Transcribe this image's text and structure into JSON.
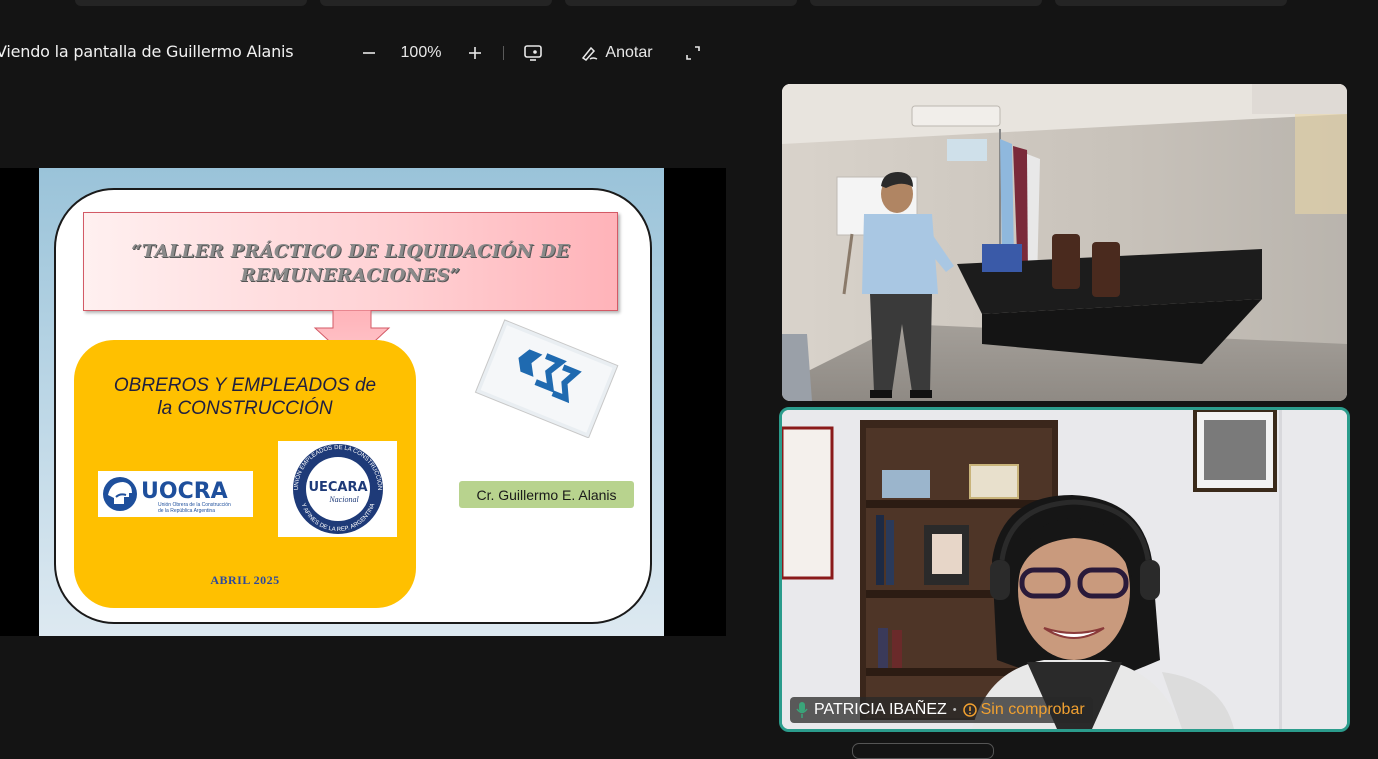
{
  "toolbar": {
    "share_title": "Viendo la pantalla de Guillermo Alanis",
    "zoom_out_icon": "minus-icon",
    "zoom_level": "100%",
    "zoom_in_icon": "plus-icon",
    "present_icon": "present-screen-icon",
    "annotate_label": "Anotar",
    "annotate_icon": "pen-icon",
    "expand_icon": "expand-icon"
  },
  "slide": {
    "title_line1": "“TALLER  PRÁCTICO DE LIQUIDACIÓN DE",
    "title_line2": "REMUNERACIONES”",
    "subtitle_line1": "OBREROS Y EMPLEADOS de",
    "subtitle_line2": "la CONSTRUCCIÓN",
    "uocra_name": "UOCRA",
    "uocra_tagline_1": "Unión Obrera de la Construcción",
    "uocra_tagline_2": "de la República Argentina",
    "uecara_name": "UECARA",
    "uecara_sub": "Nacional",
    "uecara_ring_top": "UNIÓN EMPLEADOS DE LA CONSTRUCCIÓN",
    "uecara_ring_bottom": "Y AFINES DE LA REP. ARGENTINA",
    "date": "ABRIL 2025",
    "author": "Cr. Guillermo E. Alanis"
  },
  "participants": [
    {
      "name": "",
      "view": "camera"
    },
    {
      "name": "PATRICIA IBAÑEZ",
      "status": "Sin comprobar",
      "mic_icon": "mic-icon",
      "status_icon": "unverified-icon"
    }
  ],
  "colors": {
    "background": "#141414",
    "active_speaker_border": "#2b9c8c",
    "unverified": "#f0a030",
    "slide_yellow": "#ffc000"
  }
}
